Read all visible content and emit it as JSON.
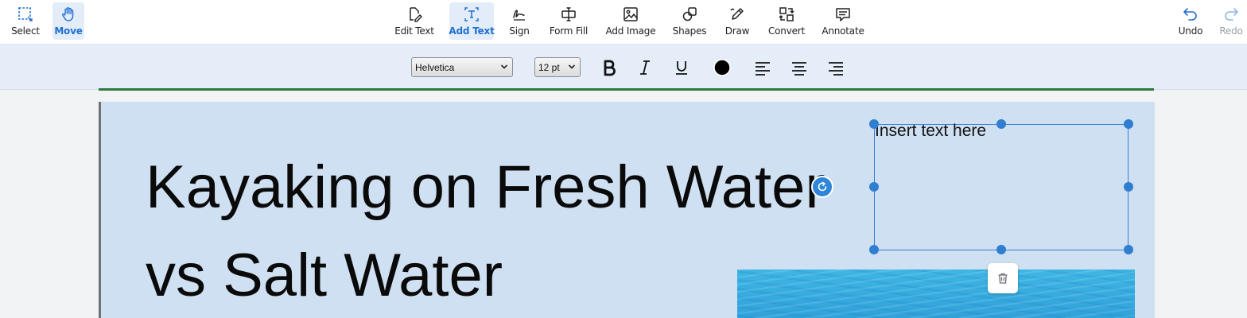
{
  "toolbar": {
    "left_tools": [
      {
        "label": "Select",
        "icon": "select-icon"
      },
      {
        "label": "Move",
        "icon": "hand-icon",
        "active": true
      }
    ],
    "center_tools": [
      {
        "label": "Edit Text",
        "icon": "edit-text-icon"
      },
      {
        "label": "Add Text",
        "icon": "add-text-icon",
        "active": true
      },
      {
        "label": "Sign",
        "icon": "signature-icon"
      },
      {
        "label": "Form Fill",
        "icon": "form-fill-icon"
      },
      {
        "label": "Add Image",
        "icon": "image-icon"
      },
      {
        "label": "Shapes",
        "icon": "shapes-icon"
      },
      {
        "label": "Draw",
        "icon": "pencil-icon"
      },
      {
        "label": "Convert",
        "icon": "convert-icon"
      },
      {
        "label": "Annotate",
        "icon": "comment-icon"
      }
    ],
    "right_tools": [
      {
        "label": "Undo",
        "icon": "undo-icon"
      },
      {
        "label": "Redo",
        "icon": "redo-icon",
        "disabled": true
      }
    ]
  },
  "format_bar": {
    "font_family": "Helvetica",
    "font_size": "12 pt",
    "bold_icon": "bold-icon",
    "italic_icon": "italic-icon",
    "underline_icon": "underline-icon",
    "text_color": "#000000",
    "align_icons": [
      "align-left-icon",
      "align-center-icon",
      "align-right-icon"
    ]
  },
  "document": {
    "title_line_1": "Kayaking on Fresh Water",
    "title_line_2": "vs Salt Water",
    "text_box": {
      "placeholder": "Insert text here"
    }
  },
  "colors": {
    "accent": "#1f6fd0",
    "page_background": "#cfe0f2",
    "format_bar_background": "#e4edf8"
  }
}
